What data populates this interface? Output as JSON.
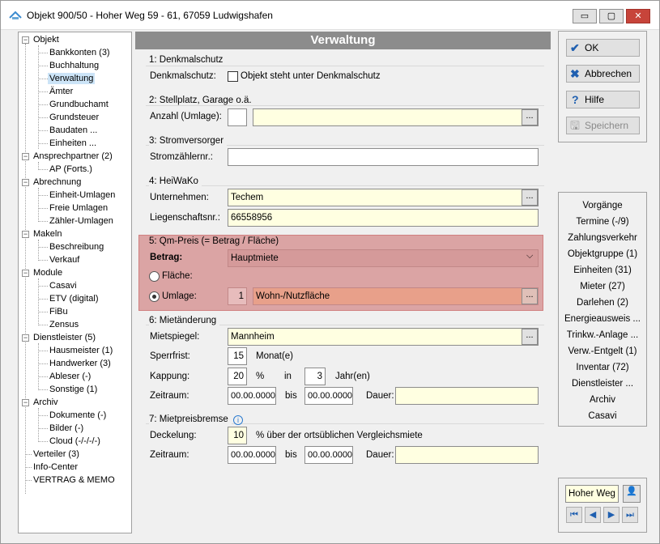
{
  "window": {
    "title": "Objekt 900/50 - Hoher Weg 59 - 61, 67059 Ludwigshafen",
    "min": "▭",
    "max": "▢",
    "close": "✕"
  },
  "tree": {
    "objekt": "Objekt",
    "bankkonten": "Bankkonten (3)",
    "buchhaltung": "Buchhaltung",
    "verwaltung": "Verwaltung",
    "aemter": "Ämter",
    "grundbuchamt": "Grundbuchamt",
    "grundsteuer": "Grundsteuer",
    "baudaten": "Baudaten ...",
    "einheiten": "Einheiten ...",
    "ansprechpartner": "Ansprechpartner (2)",
    "ap": "AP (Forts.)",
    "abrechnung": "Abrechnung",
    "einheit_umlagen": "Einheit-Umlagen",
    "freie_umlagen": "Freie Umlagen",
    "zaehler_umlagen": "Zähler-Umlagen",
    "makeln": "Makeln",
    "beschreibung": "Beschreibung",
    "verkauf": "Verkauf",
    "module": "Module",
    "casavi": "Casavi",
    "etv": "ETV (digital)",
    "fibu": "FiBu",
    "zensus": "Zensus",
    "dienstleister": "Dienstleister (5)",
    "hausmeister": "Hausmeister (1)",
    "handwerker": "Handwerker (3)",
    "ableser": "Ableser (-)",
    "sonstige": "Sonstige (1)",
    "archiv": "Archiv",
    "dokumente": "Dokumente (-)",
    "bilder": "Bilder (-)",
    "cloud": "Cloud (-/-/-/-)",
    "verteiler": "Verteiler (3)",
    "infocenter": "Info-Center",
    "vertrag": "VERTRAG & MEMO",
    "minus": "−"
  },
  "main": {
    "header": "Verwaltung",
    "g1": {
      "title": "1: Denkmalschutz",
      "label": "Denkmalschutz:",
      "check": "Objekt steht unter Denkmalschutz"
    },
    "g2": {
      "title": "2: Stellplatz, Garage o.ä.",
      "label": "Anzahl (Umlage):",
      "count": "",
      "text": ""
    },
    "g3": {
      "title": "3: Stromversorger",
      "label": "Stromzählernr.:",
      "value": ""
    },
    "g4": {
      "title": "4: HeiWaKo",
      "l1": "Unternehmen:",
      "v1": "Techem",
      "l2": "Liegenschaftsnr.:",
      "v2": "66558956"
    },
    "g5": {
      "title": "5: Qm-Preis (= Betrag / Fläche)",
      "betrag_label": "Betrag:",
      "betrag_value": "Hauptmiete",
      "flaeche": "Fläche:",
      "umlage": "Umlage:",
      "umlage_num": "1",
      "umlage_value": "Wohn-/Nutzfläche",
      "chevron": "⌵"
    },
    "g6": {
      "title": "6: Mietänderung",
      "mietspiegel_label": "Mietspiegel:",
      "mietspiegel": "Mannheim",
      "sperrfrist_label": "Sperrfrist:",
      "sperrfrist": "15",
      "monate": "Monat(e)",
      "kappung_label": "Kappung:",
      "kappung": "20",
      "pct": "%",
      "in": "in",
      "jahre_val": "3",
      "jahre": "Jahr(en)",
      "zeitraum_label": "Zeitraum:",
      "von": "00.00.0000",
      "bis_label": "bis",
      "bis": "00.00.0000",
      "dauer_label": "Dauer:",
      "dauer": ""
    },
    "g7": {
      "title": "7: Mietpreisbremse",
      "info": "i",
      "deckelung_label": "Deckelung:",
      "deckelung": "10",
      "deckelung_text": "% über der ortsüblichen Vergleichsmiete",
      "zeitraum_label": "Zeitraum:",
      "von": "00.00.0000",
      "bis_label": "bis",
      "bis": "00.00.0000",
      "dauer_label": "Dauer:",
      "dauer": ""
    },
    "dots": "..."
  },
  "buttons": {
    "ok": "OK",
    "abbrechen": "Abbrechen",
    "hilfe": "Hilfe",
    "speichern": "Speichern",
    "ok_icon": "✔",
    "abbrechen_icon": "✖",
    "hilfe_icon": "?",
    "speichern_icon": "🖫"
  },
  "links": [
    "Vorgänge",
    "Termine (-/9)",
    "Zahlungsverkehr",
    "Objektgruppe (1)",
    "Einheiten (31)",
    "Mieter (27)",
    "Darlehen (2)",
    "Energieausweis ...",
    "Trinkw.-Anlage ...",
    "Verw.-Entgelt (1)",
    "Inventar (72)",
    "Dienstleister ...",
    "Archiv",
    "Casavi"
  ],
  "footer": {
    "name": "Hoher Weg",
    "first": "⏮",
    "prev": "◀",
    "next": "▶",
    "last": "⏭",
    "person": "👤"
  },
  "colors": {
    "header": "#8c8c8c",
    "highlight": "#dba4a4",
    "input_yellow": "#ffffe1",
    "accent": "#1f5fb0"
  }
}
